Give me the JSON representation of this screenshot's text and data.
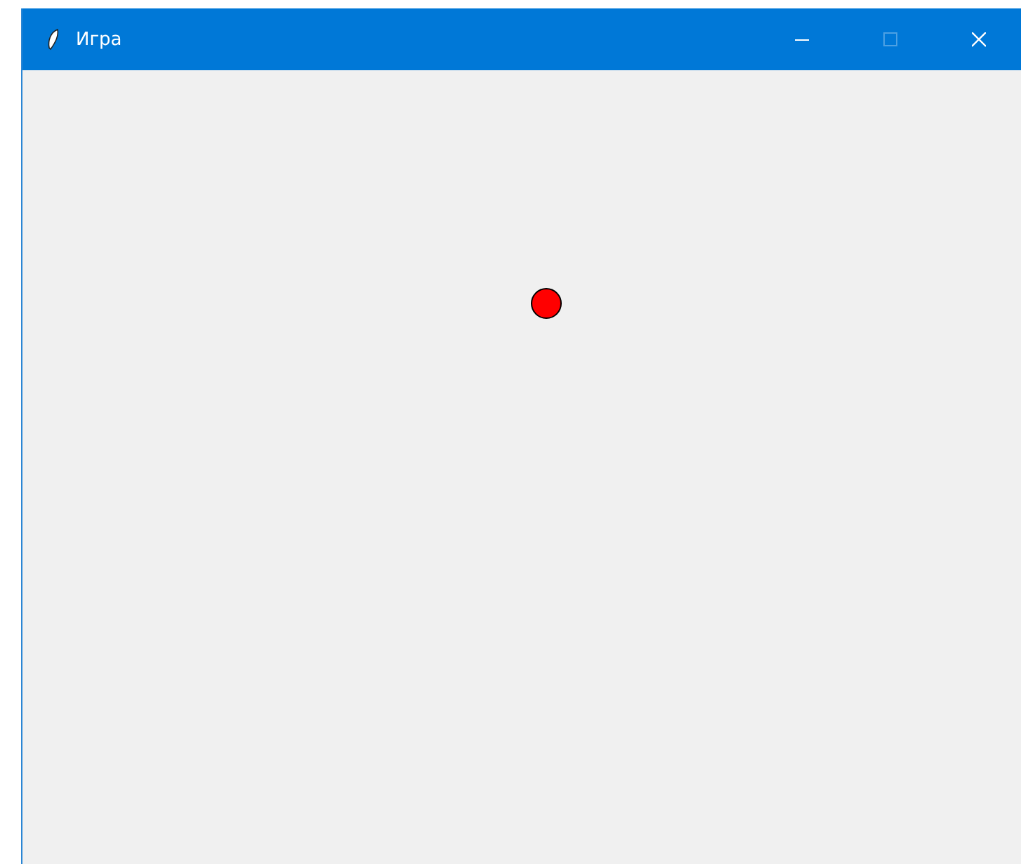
{
  "window": {
    "title": "Игра",
    "controls": [
      {
        "kind": "minimize",
        "disabled": false
      },
      {
        "kind": "maximize",
        "disabled": true
      },
      {
        "kind": "close",
        "disabled": false
      }
    ]
  },
  "canvas": {
    "shapes": [
      {
        "kind": "ball"
      }
    ]
  }
}
